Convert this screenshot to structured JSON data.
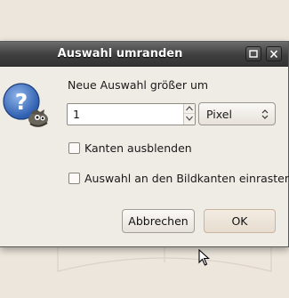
{
  "window": {
    "title": "Auswahl umranden"
  },
  "dialog": {
    "prompt": "Neue Auswahl größer um",
    "amount_value": "1",
    "unit_selected": "Pixel",
    "checkboxes": [
      {
        "label": "Kanten ausblenden",
        "checked": false
      },
      {
        "label": "Auswahl an den Bildkanten einrasten",
        "checked": false
      }
    ],
    "buttons": {
      "cancel_label": "Abbrechen",
      "ok_label": "OK"
    }
  },
  "icons": [
    "maximize-icon",
    "close-icon",
    "question-wilber-icon",
    "spin-up-icon",
    "spin-down-icon",
    "combo-arrows-icon",
    "mouse-pointer-icon"
  ],
  "colors": {
    "titlebar": "#3f3f3f",
    "dialog_bg": "#efebe5",
    "question_blue": "#3a6fc4"
  }
}
